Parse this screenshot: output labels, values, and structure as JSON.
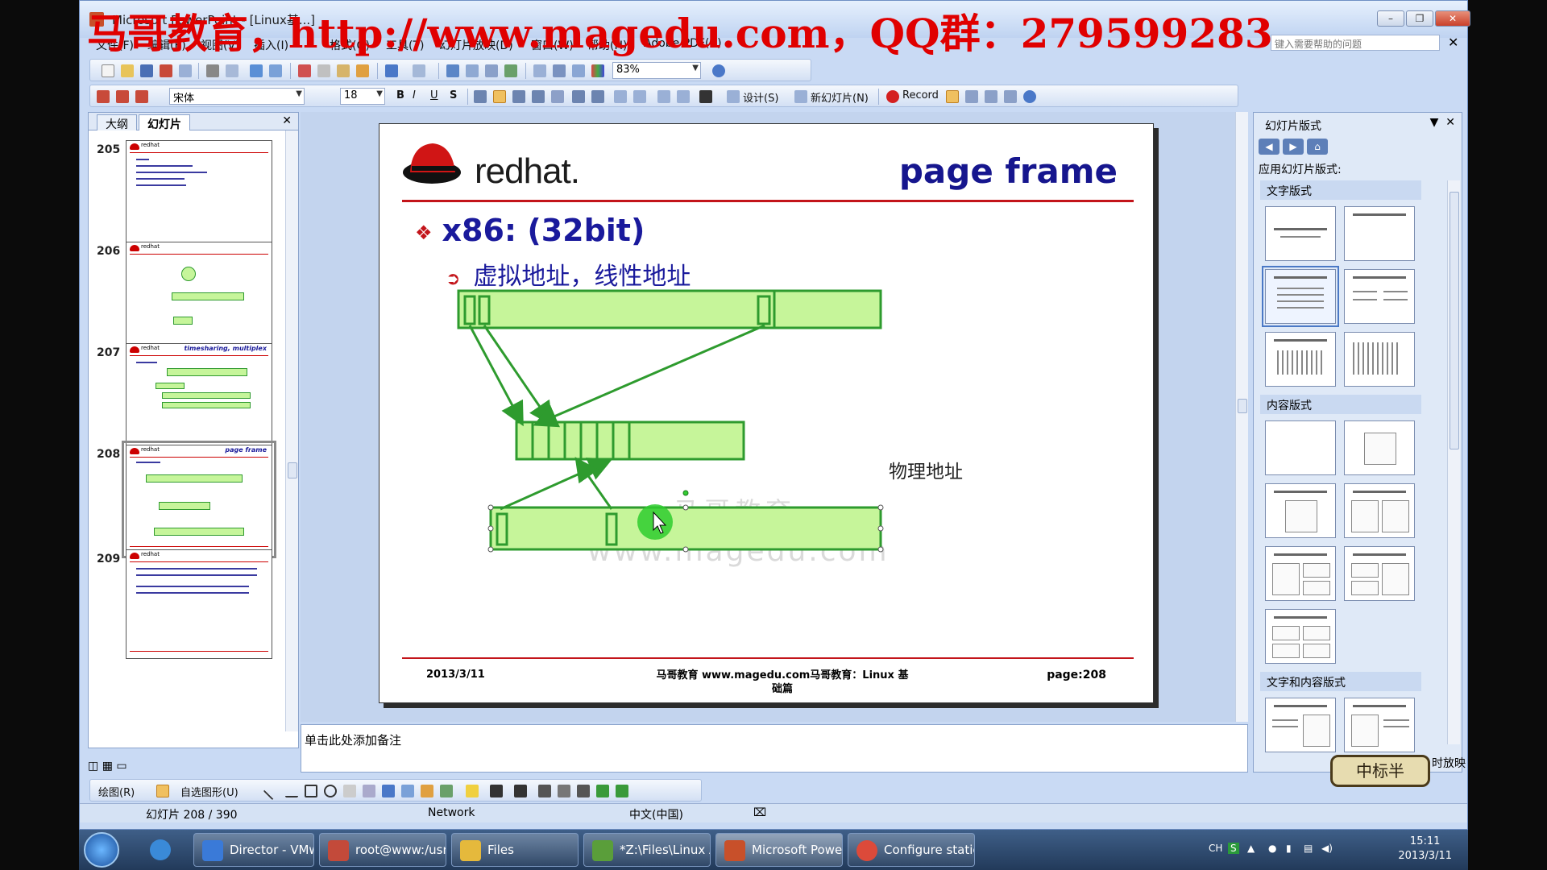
{
  "overlay_text": "马哥教育，http://www.magedu.com，QQ群：279599283",
  "window": {
    "title": "Microsoft PowerPoint - [Linux基...]",
    "controls": {
      "minimize": "–",
      "restore": "❐",
      "close": "✕"
    }
  },
  "menubar": {
    "items": [
      "文件(F)",
      "编辑(E)",
      "视图(V)",
      "插入(I)",
      "格式(O)",
      "工具(T)",
      "幻灯片放映(D)",
      "窗口(W)",
      "帮助(H)",
      "Adobe PDF(B)"
    ],
    "help_search_placeholder": "键入需要帮助的问题",
    "help_close": "✕"
  },
  "toolbar_standard": {
    "zoom": "83%"
  },
  "toolbar_format": {
    "font_name": "宋体",
    "font_size": "18",
    "bold": "B",
    "italic": "I",
    "underline": "U",
    "shadow": "S",
    "design_label": "设计(S)",
    "new_slide_label": "新幻灯片(N)",
    "record_label": "Record"
  },
  "left_panel": {
    "tabs": [
      "大纲",
      "幻灯片"
    ],
    "active_tab": "幻灯片",
    "close": "✕",
    "thumbnails": [
      {
        "num": "205",
        "title": ""
      },
      {
        "num": "206",
        "title": ""
      },
      {
        "num": "207",
        "title": "timesharing, multiplex"
      },
      {
        "num": "208",
        "title": "page frame"
      },
      {
        "num": "209",
        "title": ""
      }
    ],
    "selected": "208"
  },
  "slide": {
    "brand": "redhat.",
    "title": "page frame",
    "bullet1": "x86: (32bit)",
    "bullet1_mark": "❖",
    "bullet2": "虚拟地址，线性地址",
    "bullet2_mark": "➲",
    "physical_label": "物理地址",
    "watermark1": "马哥教育",
    "watermark2": "www.magedu.com",
    "footer_date": "2013/3/11",
    "footer_center": "马哥教育 www.magedu.com马哥教育：Linux 基础篇",
    "footer_page": "page:208",
    "colors": {
      "box_fill": "#c6f59a",
      "box_stroke": "#2e9b2e",
      "rule": "#c3141a",
      "title": "#16168e"
    }
  },
  "notes": {
    "placeholder": "单击此处添加备注"
  },
  "task_pane": {
    "title": "幻灯片版式",
    "apply_label": "应用幻灯片版式:",
    "sections": [
      "文字版式",
      "内容版式",
      "文字和内容版式"
    ],
    "close": "✕",
    "dropdown": "▼"
  },
  "ime_badge": "中标半",
  "ime_after": "时放映",
  "drawbar": {
    "draw_label": "绘图(R)",
    "autoshape_label": "自选图形(U)"
  },
  "statusbar": {
    "slide_info": "幻灯片 208 / 390",
    "theme": "Network",
    "language": "中文(中国)"
  },
  "taskbar": {
    "tasks": [
      {
        "label": "Director - VMw...",
        "icon_color": "#3a7ad8"
      },
      {
        "label": "root@www:/usr/...",
        "icon_color": "#c34a3a"
      },
      {
        "label": "Files",
        "icon_color": "#e5b93c"
      },
      {
        "label": "*Z:\\Files\\Linux A...",
        "icon_color": "#5a9e3a"
      },
      {
        "label": "Microsoft Powe...",
        "icon_color": "#c8502a"
      },
      {
        "label": "Configure static ...",
        "icon_color": "#dc4a3a"
      }
    ],
    "tray": {
      "lang": "CH",
      "time": "15:11",
      "date": "2013/3/11"
    }
  }
}
